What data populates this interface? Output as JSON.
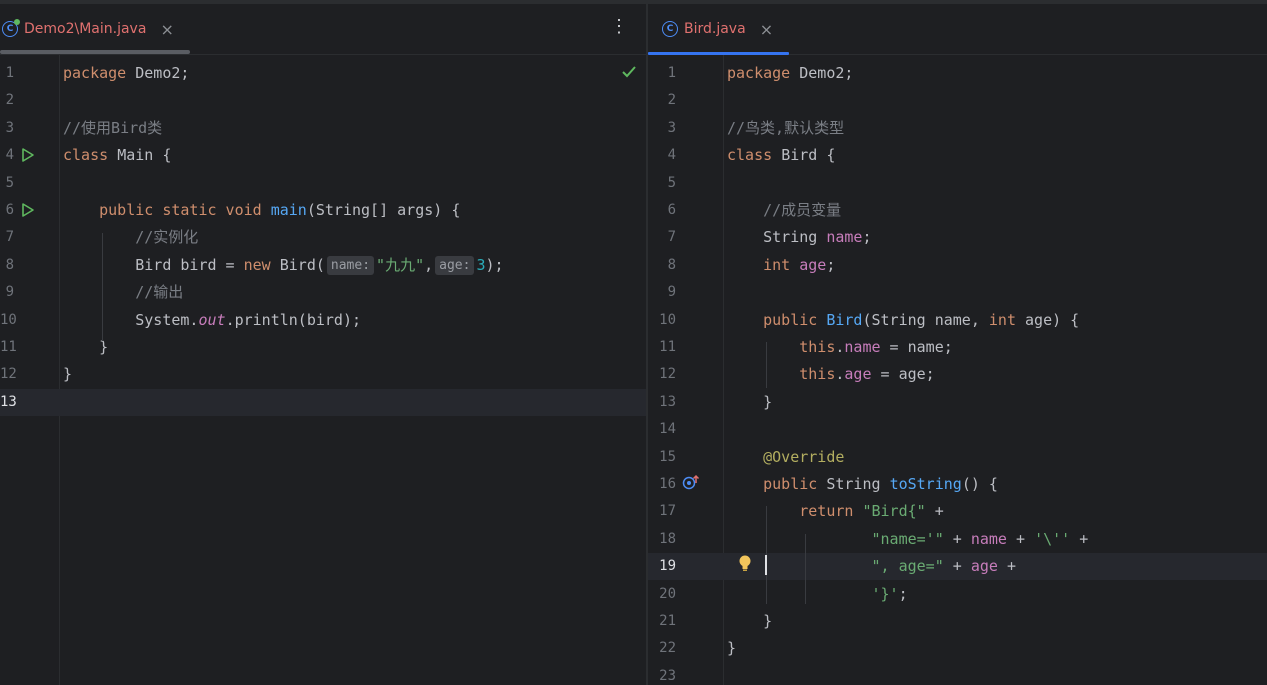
{
  "editor_left": {
    "tab": {
      "label": "Demo2\\Main.java",
      "close": "×",
      "icon": "class-icon"
    },
    "menu": "⋮",
    "inspection": "check-icon",
    "lines": [
      {
        "num": "1",
        "tokens": [
          {
            "t": "package ",
            "c": "kw"
          },
          {
            "t": "Demo2;",
            "c": ""
          }
        ]
      },
      {
        "num": "2",
        "tokens": []
      },
      {
        "num": "3",
        "tokens": [
          {
            "t": "//使用Bird类",
            "c": "cm"
          }
        ]
      },
      {
        "num": "4",
        "tokens": [
          {
            "t": "class ",
            "c": "kw"
          },
          {
            "t": "Main {",
            "c": ""
          }
        ]
      },
      {
        "num": "5",
        "tokens": []
      },
      {
        "num": "6",
        "tokens": [
          {
            "t": "    ",
            "c": ""
          },
          {
            "t": "public static void ",
            "c": "kw"
          },
          {
            "t": "main",
            "c": "fn"
          },
          {
            "t": "(String[] args) {",
            "c": ""
          }
        ]
      },
      {
        "num": "7",
        "tokens": [
          {
            "t": "        ",
            "c": ""
          },
          {
            "t": "//实例化",
            "c": "cm"
          }
        ]
      },
      {
        "num": "8",
        "tokens": [
          {
            "t": "        Bird bird = ",
            "c": ""
          },
          {
            "t": "new ",
            "c": "kw"
          },
          {
            "t": "Bird(",
            "c": ""
          },
          {
            "t": "name:",
            "c": "hint"
          },
          {
            "t": "\"九九\"",
            "c": "str"
          },
          {
            "t": ",",
            "c": ""
          },
          {
            "t": "age:",
            "c": "hint"
          },
          {
            "t": "3",
            "c": "num"
          },
          {
            "t": ");",
            "c": ""
          }
        ]
      },
      {
        "num": "9",
        "tokens": [
          {
            "t": "        ",
            "c": ""
          },
          {
            "t": "//输出",
            "c": "cm"
          }
        ]
      },
      {
        "num": "10",
        "tokens": [
          {
            "t": "        System.",
            "c": ""
          },
          {
            "t": "out",
            "c": "stat"
          },
          {
            "t": ".println(bird);",
            "c": ""
          }
        ]
      },
      {
        "num": "11",
        "tokens": [
          {
            "t": "    }",
            "c": ""
          }
        ]
      },
      {
        "num": "12",
        "tokens": [
          {
            "t": "}",
            "c": ""
          }
        ]
      },
      {
        "num": "13",
        "tokens": []
      }
    ]
  },
  "editor_right": {
    "tab": {
      "label": "Bird.java",
      "close": "×",
      "icon": "class-icon"
    },
    "lines": [
      {
        "num": "1",
        "tokens": [
          {
            "t": "package ",
            "c": "kw"
          },
          {
            "t": "Demo2;",
            "c": ""
          }
        ]
      },
      {
        "num": "2",
        "tokens": []
      },
      {
        "num": "3",
        "tokens": [
          {
            "t": "//鸟类,默认类型",
            "c": "cm"
          }
        ]
      },
      {
        "num": "4",
        "tokens": [
          {
            "t": "class ",
            "c": "kw"
          },
          {
            "t": "Bird {",
            "c": ""
          }
        ]
      },
      {
        "num": "5",
        "tokens": []
      },
      {
        "num": "6",
        "tokens": [
          {
            "t": "    ",
            "c": ""
          },
          {
            "t": "//成员变量",
            "c": "cm"
          }
        ]
      },
      {
        "num": "7",
        "tokens": [
          {
            "t": "    String ",
            "c": ""
          },
          {
            "t": "name",
            "c": "fld"
          },
          {
            "t": ";",
            "c": ""
          }
        ]
      },
      {
        "num": "8",
        "tokens": [
          {
            "t": "    ",
            "c": ""
          },
          {
            "t": "int ",
            "c": "kw"
          },
          {
            "t": "age",
            "c": "fld"
          },
          {
            "t": ";",
            "c": ""
          }
        ]
      },
      {
        "num": "9",
        "tokens": []
      },
      {
        "num": "10",
        "tokens": [
          {
            "t": "    ",
            "c": ""
          },
          {
            "t": "public ",
            "c": "kw"
          },
          {
            "t": "Bird",
            "c": "fn"
          },
          {
            "t": "(String name, ",
            "c": ""
          },
          {
            "t": "int ",
            "c": "kw"
          },
          {
            "t": "age) {",
            "c": ""
          }
        ]
      },
      {
        "num": "11",
        "tokens": [
          {
            "t": "        ",
            "c": ""
          },
          {
            "t": "this",
            "c": "kw"
          },
          {
            "t": ".",
            "c": ""
          },
          {
            "t": "name",
            "c": "fld"
          },
          {
            "t": " = name;",
            "c": ""
          }
        ]
      },
      {
        "num": "12",
        "tokens": [
          {
            "t": "        ",
            "c": ""
          },
          {
            "t": "this",
            "c": "kw"
          },
          {
            "t": ".",
            "c": ""
          },
          {
            "t": "age",
            "c": "fld"
          },
          {
            "t": " = age;",
            "c": ""
          }
        ]
      },
      {
        "num": "13",
        "tokens": [
          {
            "t": "    }",
            "c": ""
          }
        ]
      },
      {
        "num": "14",
        "tokens": []
      },
      {
        "num": "15",
        "tokens": [
          {
            "t": "    ",
            "c": ""
          },
          {
            "t": "@Override",
            "c": "ann"
          }
        ]
      },
      {
        "num": "16",
        "tokens": [
          {
            "t": "    ",
            "c": ""
          },
          {
            "t": "public ",
            "c": "kw"
          },
          {
            "t": "String ",
            "c": ""
          },
          {
            "t": "toString",
            "c": "fn"
          },
          {
            "t": "() {",
            "c": ""
          }
        ]
      },
      {
        "num": "17",
        "tokens": [
          {
            "t": "        ",
            "c": ""
          },
          {
            "t": "return ",
            "c": "kw"
          },
          {
            "t": "\"Bird{\"",
            "c": "str"
          },
          {
            "t": " +",
            "c": ""
          }
        ]
      },
      {
        "num": "18",
        "tokens": [
          {
            "t": "                ",
            "c": ""
          },
          {
            "t": "\"name='\"",
            "c": "str"
          },
          {
            "t": " + ",
            "c": ""
          },
          {
            "t": "name",
            "c": "fld"
          },
          {
            "t": " + ",
            "c": ""
          },
          {
            "t": "'\\''",
            "c": "str"
          },
          {
            "t": " +",
            "c": ""
          }
        ]
      },
      {
        "num": "19",
        "tokens": [
          {
            "t": "                ",
            "c": ""
          },
          {
            "t": "\", age=\"",
            "c": "str"
          },
          {
            "t": " + ",
            "c": ""
          },
          {
            "t": "age",
            "c": "fld"
          },
          {
            "t": " +",
            "c": ""
          }
        ]
      },
      {
        "num": "20",
        "tokens": [
          {
            "t": "                ",
            "c": ""
          },
          {
            "t": "'}'",
            "c": "str"
          },
          {
            "t": ";",
            "c": ""
          }
        ]
      },
      {
        "num": "21",
        "tokens": [
          {
            "t": "    }",
            "c": ""
          }
        ]
      },
      {
        "num": "22",
        "tokens": [
          {
            "t": "}",
            "c": ""
          }
        ]
      },
      {
        "num": "23",
        "tokens": []
      }
    ]
  },
  "colors": {
    "tab_active_left": "#e0716f",
    "tab_active_right": "#e0716f",
    "accent": "#3574f0",
    "current_line": "#26282e"
  }
}
